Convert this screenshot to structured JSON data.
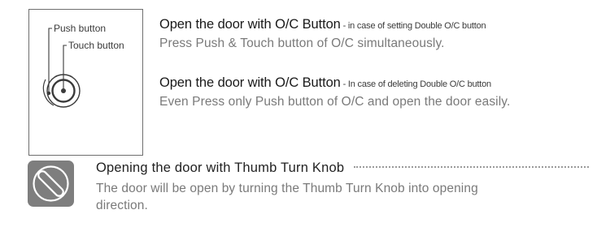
{
  "diagram": {
    "push_label": "Push button",
    "touch_label": "Touch button"
  },
  "instructions": [
    {
      "title": "Open the door with O/C  Button",
      "note": " - in case of setting Double O/C button",
      "body": "Press Push & Touch button of O/C simultaneously."
    },
    {
      "title": "Open the door with O/C Button",
      "note": " - In case of deleting Double O/C button",
      "body": "Even Press only Push button of O/C and open the door easily."
    }
  ],
  "thumb_turn": {
    "icon": "thumb-turn-knob-icon",
    "title": "Opening the door with Thumb Turn Knob",
    "body": "The door will be open by turning the Thumb Turn Knob into opening direction."
  },
  "colors": {
    "border": "#6e6e6e",
    "icon_bg": "#7e7e7e",
    "body_text": "#7a7a7a",
    "title_text": "#1a1a1a"
  }
}
